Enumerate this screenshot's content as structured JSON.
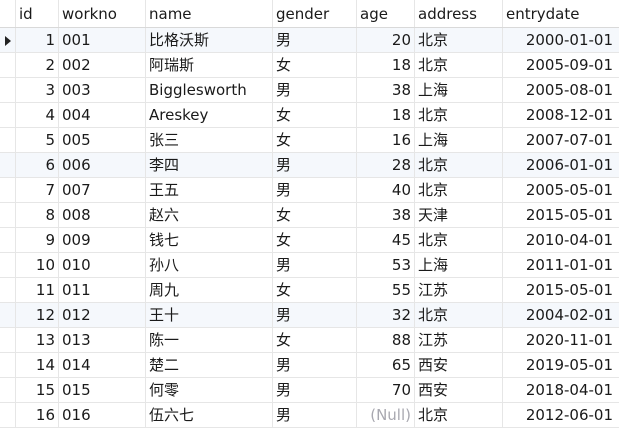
{
  "columns": {
    "id": "id",
    "workno": "workno",
    "name": "name",
    "gender": "gender",
    "age": "age",
    "address": "address",
    "entrydate": "entrydate"
  },
  "null_label": "(Null)",
  "rows": [
    {
      "id": "1",
      "workno": "001",
      "name": "比格沃斯",
      "gender": "男",
      "age": "20",
      "address": "北京",
      "entrydate": "2000-01-01"
    },
    {
      "id": "2",
      "workno": "002",
      "name": "阿瑞斯",
      "gender": "女",
      "age": "18",
      "address": "北京",
      "entrydate": "2005-09-01"
    },
    {
      "id": "3",
      "workno": "003",
      "name": "Bigglesworth",
      "gender": "男",
      "age": "38",
      "address": "上海",
      "entrydate": "2005-08-01"
    },
    {
      "id": "4",
      "workno": "004",
      "name": "Areskey",
      "gender": "女",
      "age": "18",
      "address": "北京",
      "entrydate": "2008-12-01"
    },
    {
      "id": "5",
      "workno": "005",
      "name": "张三",
      "gender": "女",
      "age": "16",
      "address": "上海",
      "entrydate": "2007-07-01"
    },
    {
      "id": "6",
      "workno": "006",
      "name": "李四",
      "gender": "男",
      "age": "28",
      "address": "北京",
      "entrydate": "2006-01-01"
    },
    {
      "id": "7",
      "workno": "007",
      "name": "王五",
      "gender": "男",
      "age": "40",
      "address": "北京",
      "entrydate": "2005-05-01"
    },
    {
      "id": "8",
      "workno": "008",
      "name": "赵六",
      "gender": "女",
      "age": "38",
      "address": "天津",
      "entrydate": "2015-05-01"
    },
    {
      "id": "9",
      "workno": "009",
      "name": "钱七",
      "gender": "女",
      "age": "45",
      "address": "北京",
      "entrydate": "2010-04-01"
    },
    {
      "id": "10",
      "workno": "010",
      "name": "孙八",
      "gender": "男",
      "age": "53",
      "address": "上海",
      "entrydate": "2011-01-01"
    },
    {
      "id": "11",
      "workno": "011",
      "name": "周九",
      "gender": "女",
      "age": "55",
      "address": "江苏",
      "entrydate": "2015-05-01"
    },
    {
      "id": "12",
      "workno": "012",
      "name": "王十",
      "gender": "男",
      "age": "32",
      "address": "北京",
      "entrydate": "2004-02-01"
    },
    {
      "id": "13",
      "workno": "013",
      "name": "陈一",
      "gender": "女",
      "age": "88",
      "address": "江苏",
      "entrydate": "2020-11-01"
    },
    {
      "id": "14",
      "workno": "014",
      "name": "楚二",
      "gender": "男",
      "age": "65",
      "address": "西安",
      "entrydate": "2019-05-01"
    },
    {
      "id": "15",
      "workno": "015",
      "name": "何零",
      "gender": "男",
      "age": "70",
      "address": "西安",
      "entrydate": "2018-04-01"
    },
    {
      "id": "16",
      "workno": "016",
      "name": "伍六七",
      "gender": "男",
      "age": null,
      "address": "北京",
      "entrydate": "2012-06-01"
    }
  ],
  "selected_row_index": 0,
  "highlighted_row_indices": [
    5,
    11
  ],
  "colors": {
    "row_highlight": "#f5f8fc",
    "gridline": "#e6e6e6",
    "null_text": "#a8a8b0"
  },
  "icons": {
    "row_pointer": "current-row-pointer-icon"
  }
}
